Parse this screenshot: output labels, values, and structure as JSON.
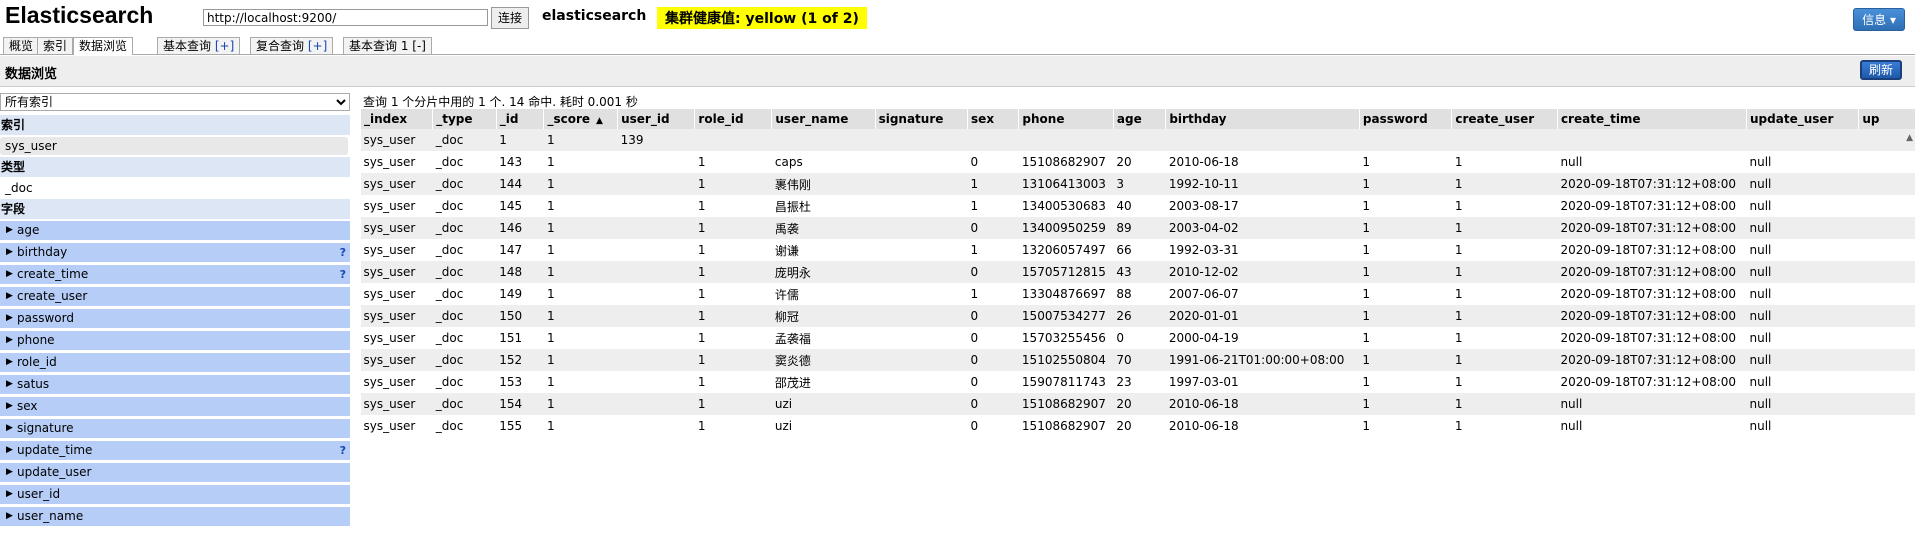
{
  "app_title": "Elasticsearch",
  "connection": {
    "url": "http://localhost:9200/",
    "connect_label": "连接",
    "cluster_name": "elasticsearch",
    "health": "集群健康值: yellow (1 of 2)",
    "info_label": "信息 ▾"
  },
  "tabs": [
    {
      "label": "概览",
      "extra": ""
    },
    {
      "label": "索引",
      "extra": ""
    },
    {
      "label": "数据浏览",
      "extra": ""
    },
    {
      "label": "基本查询 ",
      "extra": "[+]"
    },
    {
      "label": "复合查询 ",
      "extra": "[+]"
    },
    {
      "label": "基本查询 1 [-]",
      "extra": ""
    }
  ],
  "browser": {
    "title": "数据浏览",
    "refresh_label": "刷新"
  },
  "sidebar": {
    "index_select": "所有索引",
    "index_heading": "索引",
    "index_item": "sys_user",
    "type_heading": "类型",
    "type_item": "_doc",
    "fields_heading": "字段",
    "fields": [
      {
        "name": "age",
        "flag": ""
      },
      {
        "name": "birthday",
        "flag": "?"
      },
      {
        "name": "create_time",
        "flag": "?"
      },
      {
        "name": "create_user",
        "flag": ""
      },
      {
        "name": "password",
        "flag": ""
      },
      {
        "name": "phone",
        "flag": ""
      },
      {
        "name": "role_id",
        "flag": ""
      },
      {
        "name": "satus",
        "flag": ""
      },
      {
        "name": "sex",
        "flag": ""
      },
      {
        "name": "signature",
        "flag": ""
      },
      {
        "name": "update_time",
        "flag": "?"
      },
      {
        "name": "update_user",
        "flag": ""
      },
      {
        "name": "user_id",
        "flag": ""
      },
      {
        "name": "user_name",
        "flag": ""
      }
    ]
  },
  "results": {
    "summary": "查询 1 个分片中用的 1 个. 14 命中. 耗时 0.001 秒",
    "sorted_column": "_score",
    "sort_arrow": "▲",
    "columns": [
      "_index",
      "_type",
      "_id",
      "_score",
      "user_id",
      "role_id",
      "user_name",
      "signature",
      "sex",
      "phone",
      "age",
      "birthday",
      "password",
      "create_user",
      "create_time",
      "update_user",
      "up"
    ],
    "rows": [
      [
        "sys_user",
        "_doc",
        "1",
        "1",
        "139",
        "",
        "",
        "",
        "",
        "",
        "",
        "",
        "",
        "",
        "",
        "",
        ""
      ],
      [
        "sys_user",
        "_doc",
        "143",
        "1",
        "",
        "1",
        "caps",
        "",
        "0",
        "15108682907",
        "20",
        "2010-06-18",
        "1",
        "1",
        "null",
        "null",
        ""
      ],
      [
        "sys_user",
        "_doc",
        "144",
        "1",
        "",
        "1",
        "裹伟刚",
        "",
        "1",
        "13106413003",
        "3",
        "1992-10-11",
        "1",
        "1",
        "2020-09-18T07:31:12+08:00",
        "null",
        ""
      ],
      [
        "sys_user",
        "_doc",
        "145",
        "1",
        "",
        "1",
        "昌振杜",
        "",
        "1",
        "13400530683",
        "40",
        "2003-08-17",
        "1",
        "1",
        "2020-09-18T07:31:12+08:00",
        "null",
        ""
      ],
      [
        "sys_user",
        "_doc",
        "146",
        "1",
        "",
        "1",
        "禹袭",
        "",
        "0",
        "13400950259",
        "89",
        "2003-04-02",
        "1",
        "1",
        "2020-09-18T07:31:12+08:00",
        "null",
        ""
      ],
      [
        "sys_user",
        "_doc",
        "147",
        "1",
        "",
        "1",
        "谢谦",
        "",
        "1",
        "13206057497",
        "66",
        "1992-03-31",
        "1",
        "1",
        "2020-09-18T07:31:12+08:00",
        "null",
        ""
      ],
      [
        "sys_user",
        "_doc",
        "148",
        "1",
        "",
        "1",
        "庞明永",
        "",
        "0",
        "15705712815",
        "43",
        "2010-12-02",
        "1",
        "1",
        "2020-09-18T07:31:12+08:00",
        "null",
        ""
      ],
      [
        "sys_user",
        "_doc",
        "149",
        "1",
        "",
        "1",
        "许儒",
        "",
        "1",
        "13304876697",
        "88",
        "2007-06-07",
        "1",
        "1",
        "2020-09-18T07:31:12+08:00",
        "null",
        ""
      ],
      [
        "sys_user",
        "_doc",
        "150",
        "1",
        "",
        "1",
        "柳冠",
        "",
        "0",
        "15007534277",
        "26",
        "2020-01-01",
        "1",
        "1",
        "2020-09-18T07:31:12+08:00",
        "null",
        ""
      ],
      [
        "sys_user",
        "_doc",
        "151",
        "1",
        "",
        "1",
        "孟袭福",
        "",
        "0",
        "15703255456",
        "0",
        "2000-04-19",
        "1",
        "1",
        "2020-09-18T07:31:12+08:00",
        "null",
        ""
      ],
      [
        "sys_user",
        "_doc",
        "152",
        "1",
        "",
        "1",
        "窦炎德",
        "",
        "0",
        "15102550804",
        "70",
        "1991-06-21T01:00:00+08:00",
        "1",
        "1",
        "2020-09-18T07:31:12+08:00",
        "null",
        ""
      ],
      [
        "sys_user",
        "_doc",
        "153",
        "1",
        "",
        "1",
        "邵茂进",
        "",
        "0",
        "15907811743",
        "23",
        "1997-03-01",
        "1",
        "1",
        "2020-09-18T07:31:12+08:00",
        "null",
        ""
      ],
      [
        "sys_user",
        "_doc",
        "154",
        "1",
        "",
        "1",
        "uzi",
        "",
        "0",
        "15108682907",
        "20",
        "2010-06-18",
        "1",
        "1",
        "null",
        "null",
        ""
      ],
      [
        "sys_user",
        "_doc",
        "155",
        "1",
        "",
        "1",
        "uzi",
        "",
        "0",
        "15108682907",
        "20",
        "2010-06-18",
        "1",
        "1",
        "null",
        "null",
        ""
      ]
    ]
  }
}
